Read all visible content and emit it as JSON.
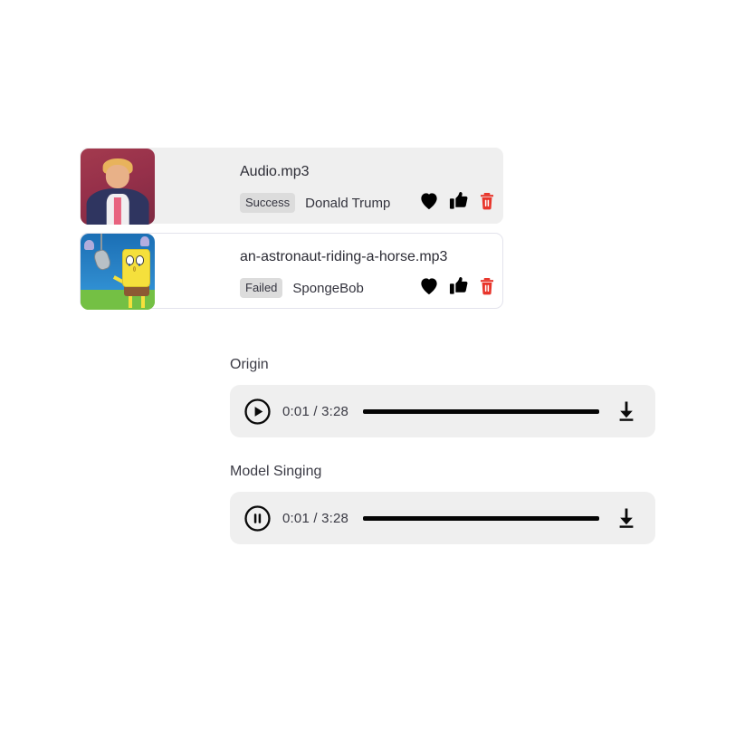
{
  "files": [
    {
      "title": "Audio.mp3",
      "status": "Success",
      "speaker": "Donald Trump",
      "thumbnail": "donald-trump-portrait-thumbnail",
      "selected": true,
      "actions": [
        "heart-icon",
        "thumbs-up-icon",
        "trash-icon"
      ]
    },
    {
      "title": "an-astronaut-riding-a-horse.mp3",
      "status": "Failed",
      "speaker": "SpongeBob",
      "thumbnail": "spongebob-underwater-thumbnail",
      "selected": false,
      "actions": [
        "heart-icon",
        "thumbs-up-icon",
        "trash-icon"
      ]
    }
  ],
  "players": [
    {
      "label": "Origin",
      "state": "play",
      "current_time": "0:01",
      "duration": "3:28",
      "time_display": "0:01 / 3:28",
      "progress_percent": 0,
      "download_icon": "download-icon"
    },
    {
      "label": "Model Singing",
      "state": "pause",
      "current_time": "0:01",
      "duration": "3:28",
      "time_display": "0:01 / 3:28",
      "progress_percent": 0,
      "download_icon": "download-icon"
    }
  ],
  "colors": {
    "page_background": "#ffffff",
    "card_selected_background": "#efefef",
    "card_border": "#e3e3ec",
    "badge_background": "#dcdcdc",
    "player_background": "#efefef",
    "delete_red": "#e8352b",
    "icon_black": "#000000",
    "text_primary": "#2c2c35"
  }
}
